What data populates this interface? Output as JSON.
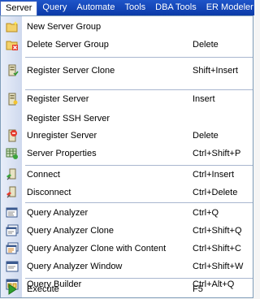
{
  "menubar": {
    "items": [
      "Server",
      "Query",
      "Automate",
      "Tools",
      "DBA Tools",
      "ER Modeler"
    ]
  },
  "menu": {
    "items": [
      {
        "label": "New Server Group",
        "shortcut": "",
        "icon": "new-folder-icon"
      },
      {
        "label": "Delete Server Group",
        "shortcut": "Delete",
        "icon": "delete-folder-icon"
      },
      {
        "label": "Register Server Clone",
        "shortcut": "Shift+Insert",
        "icon": "clone-server-icon"
      },
      {
        "label": "Register Server",
        "shortcut": "Insert",
        "icon": "register-server-icon"
      },
      {
        "label": "Register SSH Server",
        "shortcut": "",
        "icon": ""
      },
      {
        "label": "Unregister Server",
        "shortcut": "Delete",
        "icon": "unregister-server-icon"
      },
      {
        "label": "Server Properties",
        "shortcut": "Ctrl+Shift+P",
        "icon": "server-properties-icon"
      },
      {
        "label": "Connect",
        "shortcut": "Ctrl+Insert",
        "icon": "connect-icon"
      },
      {
        "label": "Disconnect",
        "shortcut": "Ctrl+Delete",
        "icon": "disconnect-icon"
      },
      {
        "label": "Query Analyzer",
        "shortcut": "Ctrl+Q",
        "icon": "query-analyzer-icon"
      },
      {
        "label": "Query Analyzer Clone",
        "shortcut": "Ctrl+Shift+Q",
        "icon": "query-analyzer-clone-icon"
      },
      {
        "label": "Query Analyzer Clone with Content",
        "shortcut": "Ctrl+Shift+C",
        "icon": "query-analyzer-clone-content-icon"
      },
      {
        "label": "Query Analyzer Window",
        "shortcut": "Ctrl+Shift+W",
        "icon": "query-analyzer-window-icon"
      },
      {
        "label": "Query Builder",
        "shortcut": "Ctrl+Alt+Q",
        "icon": "query-builder-icon"
      },
      {
        "label": "Execute",
        "shortcut": "F5",
        "icon": "execute-icon"
      }
    ]
  },
  "colors": {
    "menubar": "#0b3aa8",
    "menubar_text": "#ffffff",
    "separator": "#a9b6cf",
    "gutter": "#cfd9ee"
  }
}
